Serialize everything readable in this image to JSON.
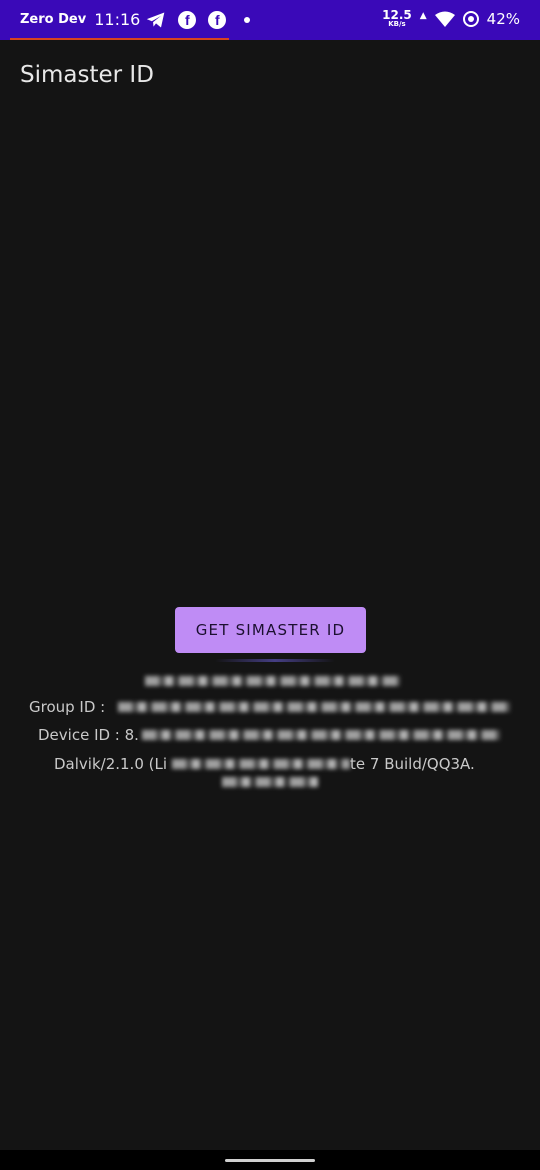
{
  "status_bar": {
    "carrier": "Zero Dev",
    "time": "11:16",
    "speed_value": "12.5",
    "speed_unit": "KB/s",
    "battery": "42%",
    "icons": [
      "telegram-icon",
      "facebook-icon",
      "facebook-icon",
      "notification-dot-icon",
      "upload-arrow-icon",
      "wifi-icon",
      "battery-saver-icon"
    ],
    "background_color": "#3a09b8"
  },
  "app_bar": {
    "title": "Simaster ID"
  },
  "main": {
    "button_label": "GET SIMASTER ID",
    "button_color": "#bf8cf5",
    "info": {
      "group_prefix": "Group ID : ",
      "device_prefix": "Device ID : 8.",
      "dalvik_prefix": "Dalvik/2.1.0 (Li",
      "dalvik_suffix": "te 7 Build/QQ3A."
    }
  }
}
